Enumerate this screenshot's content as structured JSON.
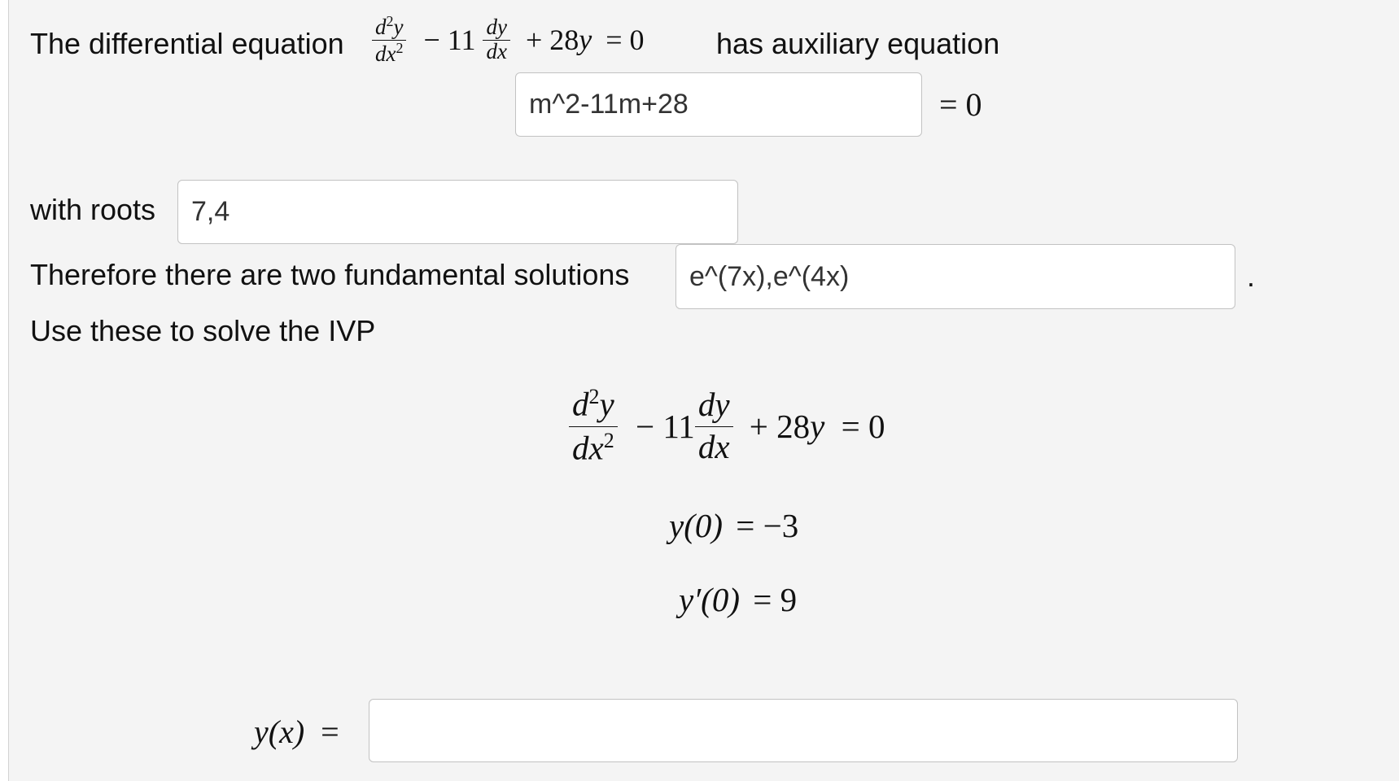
{
  "intro": {
    "prefix": "The differential equation",
    "suffix": "has auxiliary equation"
  },
  "math": {
    "d": "d",
    "y": "y",
    "x": "x",
    "sq": "2",
    "minus_11": "− 11",
    "plus_28": "+ 28",
    "eq_zero": "= 0"
  },
  "aux_equation": {
    "value": "m^2-11m+28",
    "rhs": "= 0"
  },
  "roots": {
    "label": "with roots",
    "value": "7,4"
  },
  "fundamental": {
    "label": "Therefore there are two fundamental solutions",
    "value": "e^(7x),e^(4x)",
    "period": "."
  },
  "ivp": {
    "label": "Use these to solve the IVP",
    "cond1_lhs": "y(0)",
    "cond1_rhs": "= −3",
    "cond2_lhs": "y′(0)",
    "cond2_rhs": "= 9"
  },
  "answer": {
    "label_fn": "y(x)",
    "label_eq": "=",
    "value": ""
  }
}
